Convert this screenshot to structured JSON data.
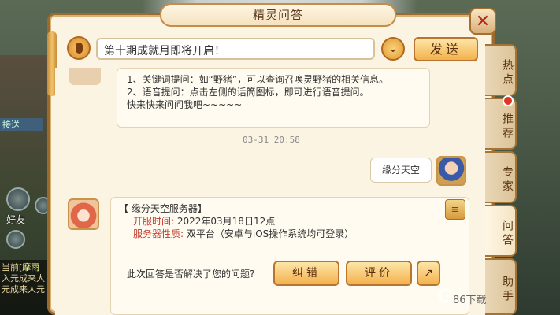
{
  "dialog": {
    "title": "精灵问答"
  },
  "input": {
    "value": "第十期成就月即将开启！",
    "send_label": "发送"
  },
  "messages": {
    "intro_line1": "1、关键词提问：如“野猪”，可以查询召唤灵野猪的相关信息。",
    "intro_line2": "2、语音提问：点击左侧的话筒图标，即可进行语音提问。",
    "intro_line3": "快来快来问问我吧~~~~~",
    "timestamp": "03-31 20:58",
    "user_text": "缘分天空",
    "server_title": "【 缘分天空服务器】",
    "open_time_label": "开服时间:",
    "open_time_value": " 2022年03月18日12点",
    "platform_label": "服务器性质:",
    "platform_value": " 双平台（安卓与iOS操作系统均可登录）",
    "question": "此次回答是否解决了您的问题?",
    "btn_error": "纠错",
    "btn_rate": "评价"
  },
  "tabs": [
    "热点",
    "推荐",
    "专家",
    "问答",
    "助手"
  ],
  "left": {
    "friend_label": "好友",
    "chat_line1": "当前",
    "chat_tag": "[摩雨",
    "chat_line2": "入元成来人",
    "chat_line3": "元成来人元"
  },
  "watermark": {
    "brand": "86下载",
    "icon": "baidu-logo"
  },
  "colors": {
    "border": "#9b6a2e",
    "accent": "#f3b14d",
    "highlight": "#c0392b"
  }
}
